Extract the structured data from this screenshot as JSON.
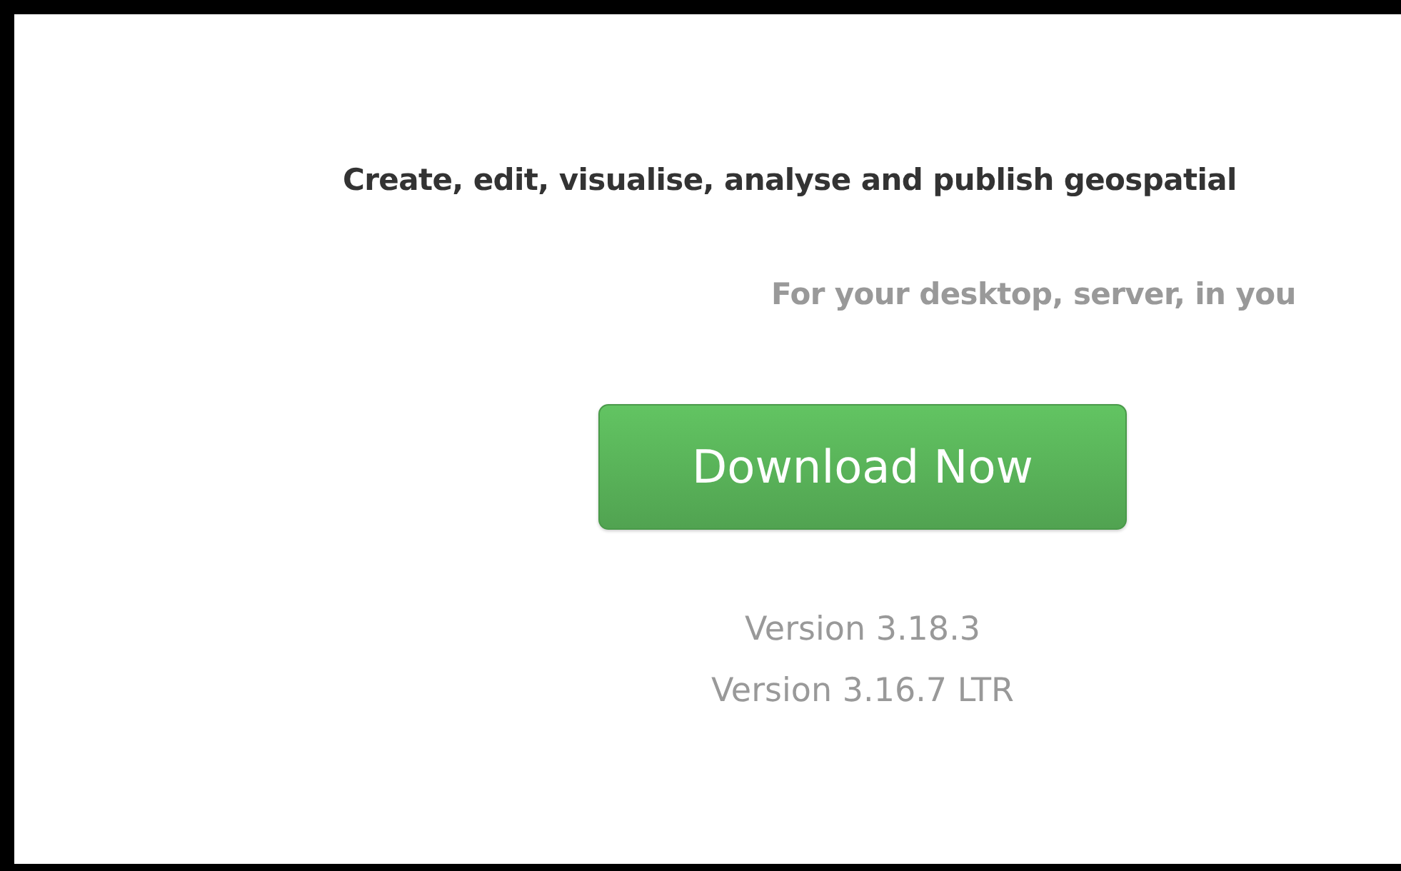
{
  "headline": "Create, edit, visualise, analyse and publish geospatial",
  "subheadline": "For your desktop, server, in you",
  "download_button": "Download Now",
  "versions": [
    "Version 3.18.3",
    "Version 3.16.7 LTR"
  ]
}
